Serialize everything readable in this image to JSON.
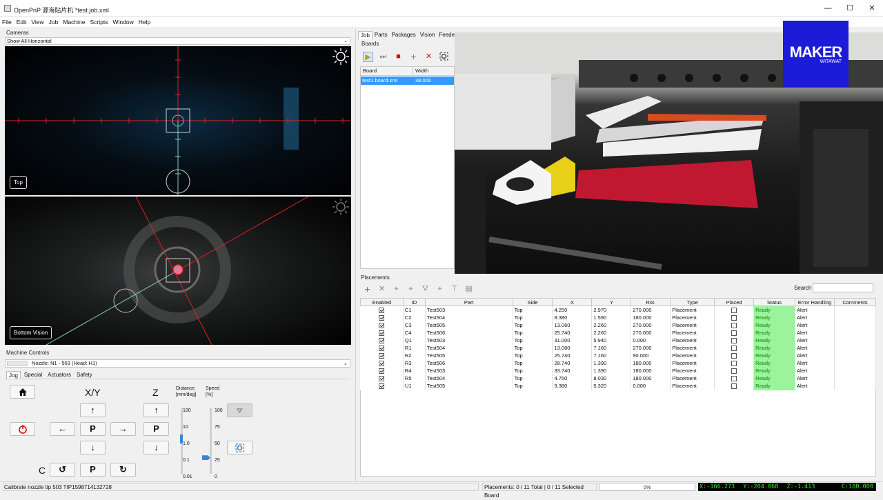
{
  "window": {
    "title": "OpenPnP 源海貼片机   *test.job.xml",
    "minimize": "—",
    "maximize": "☐",
    "close": "✕"
  },
  "menu": [
    "File",
    "Edit",
    "View",
    "Job",
    "Machine",
    "Scripts",
    "Window",
    "Help"
  ],
  "cameras": {
    "panel_label": "Cameras",
    "view_select": "Show All Horizontal",
    "top_label": "Top",
    "bottom_label": "Bottom Vision"
  },
  "machine_controls": {
    "panel_label": "Machine Controls",
    "nozzle_select": "Nozzle: N1 - 503 (Head: H1)",
    "tabs": [
      "Jog",
      "Special",
      "Actuators",
      "Safety"
    ],
    "xy_label": "X/Y",
    "z_label": "Z",
    "c_label": "C",
    "park_label": "P",
    "distance_label": "Distance\n[mm/deg]",
    "distance_l1": "Distance",
    "distance_l2": "[mm/deg]",
    "speed_l1": "Speed",
    "speed_l2": "[%]",
    "distance_ticks": [
      "100",
      "10",
      "1.0",
      "0.1",
      "0.01"
    ],
    "speed_ticks": [
      "100",
      "75",
      "50",
      "25",
      "0"
    ],
    "distance_value": "1.0",
    "speed_value_percent": 25
  },
  "job": {
    "tabs": [
      "Job",
      "Parts",
      "Packages",
      "Vision",
      "Feeders"
    ],
    "boards_label": "Boards",
    "boards_columns": [
      "Board",
      "Width"
    ],
    "boards_rows": [
      {
        "board": "test1.board.xml",
        "width": "38.000"
      }
    ]
  },
  "overlay_logo": {
    "title": "MAKER",
    "subtitle": "WITAWAT"
  },
  "placements": {
    "panel_label": "Placements",
    "search_label": "Search",
    "search_value": "",
    "columns": [
      "Enabled",
      "ID",
      "Part",
      "Side",
      "X",
      "Y",
      "Rot.",
      "Type",
      "Placed",
      "Status",
      "Error Handling",
      "Comments"
    ],
    "rows": [
      {
        "id": "C1",
        "part": "Test503",
        "side": "Top",
        "x": "4.250",
        "y": "2.970",
        "rot": "270.000",
        "type": "Placement",
        "status": "Ready",
        "err": "Alert"
      },
      {
        "id": "C2",
        "part": "Test504",
        "side": "Top",
        "x": "8.380",
        "y": "1.590",
        "rot": "180.000",
        "type": "Placement",
        "status": "Ready",
        "err": "Alert"
      },
      {
        "id": "C3",
        "part": "Test505",
        "side": "Top",
        "x": "13.060",
        "y": "2.260",
        "rot": "270.000",
        "type": "Placement",
        "status": "Ready",
        "err": "Alert"
      },
      {
        "id": "C4",
        "part": "Test506",
        "side": "Top",
        "x": "25.740",
        "y": "2.260",
        "rot": "270.000",
        "type": "Placement",
        "status": "Ready",
        "err": "Alert"
      },
      {
        "id": "Q1",
        "part": "Test503",
        "side": "Top",
        "x": "31.000",
        "y": "5.940",
        "rot": "0.000",
        "type": "Placement",
        "status": "Ready",
        "err": "Alert"
      },
      {
        "id": "R1",
        "part": "Test504",
        "side": "Top",
        "x": "13.080",
        "y": "7.160",
        "rot": "270.000",
        "type": "Placement",
        "status": "Ready",
        "err": "Alert"
      },
      {
        "id": "R2",
        "part": "Test505",
        "side": "Top",
        "x": "25.740",
        "y": "7.160",
        "rot": "90.000",
        "type": "Placement",
        "status": "Ready",
        "err": "Alert"
      },
      {
        "id": "R3",
        "part": "Test506",
        "side": "Top",
        "x": "28.740",
        "y": "1.390",
        "rot": "180.000",
        "type": "Placement",
        "status": "Ready",
        "err": "Alert"
      },
      {
        "id": "R4",
        "part": "Test503",
        "side": "Top",
        "x": "33.740",
        "y": "1.390",
        "rot": "180.000",
        "type": "Placement",
        "status": "Ready",
        "err": "Alert"
      },
      {
        "id": "R5",
        "part": "Test504",
        "side": "Top",
        "x": "4.750",
        "y": "8.030",
        "rot": "180.000",
        "type": "Placement",
        "status": "Ready",
        "err": "Alert"
      },
      {
        "id": "U1",
        "part": "Test505",
        "side": "Top",
        "x": "9.380",
        "y": "5.320",
        "rot": "0.000",
        "type": "Placement",
        "status": "Ready",
        "err": "Alert"
      }
    ]
  },
  "statusbar": {
    "message": "Calibrate nozzle tip 503 TIP1598714132728",
    "placements_summary": "Placements: 0 / 11 Total | 0 / 11 Selected Board",
    "progress_text": "0%",
    "progress_value": 0,
    "x": "X:-166.273",
    "y": "Y:-204.068",
    "z": "Z:-1.413",
    "c": "C:180.000"
  },
  "colors": {
    "status_ready_bg": "#9cf39c",
    "coords_bg": "#000000",
    "coords_fg": "#38e838",
    "selection": "#3399ff",
    "logo_bg": "#1b1bd8"
  }
}
